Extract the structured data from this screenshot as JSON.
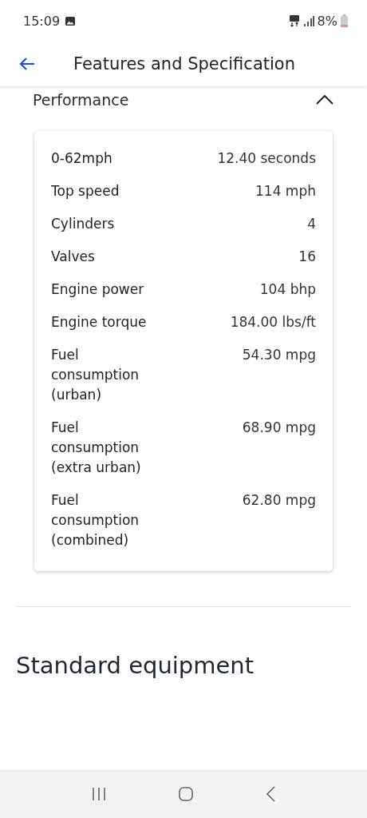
{
  "status_bar": {
    "time": "15:09",
    "battery": "8%"
  },
  "header": {
    "title": "Features and Specification"
  },
  "section": {
    "title": "Performance",
    "expanded": true,
    "rows": [
      {
        "label": "0-62mph",
        "value": "12.40 seconds"
      },
      {
        "label": "Top speed",
        "value": "114 mph"
      },
      {
        "label": "Cylinders",
        "value": "4"
      },
      {
        "label": "Valves",
        "value": "16"
      },
      {
        "label": "Engine power",
        "value": "104 bhp"
      },
      {
        "label": "Engine torque",
        "value": "184.00 lbs/ft"
      },
      {
        "label": "Fuel consumption (urban)",
        "value": "54.30 mpg"
      },
      {
        "label": "Fuel consumption (extra urban)",
        "value": "68.90 mpg"
      },
      {
        "label": "Fuel consumption (combined)",
        "value": "62.80 mpg"
      }
    ]
  },
  "next_section": {
    "title": "Standard equipment"
  }
}
